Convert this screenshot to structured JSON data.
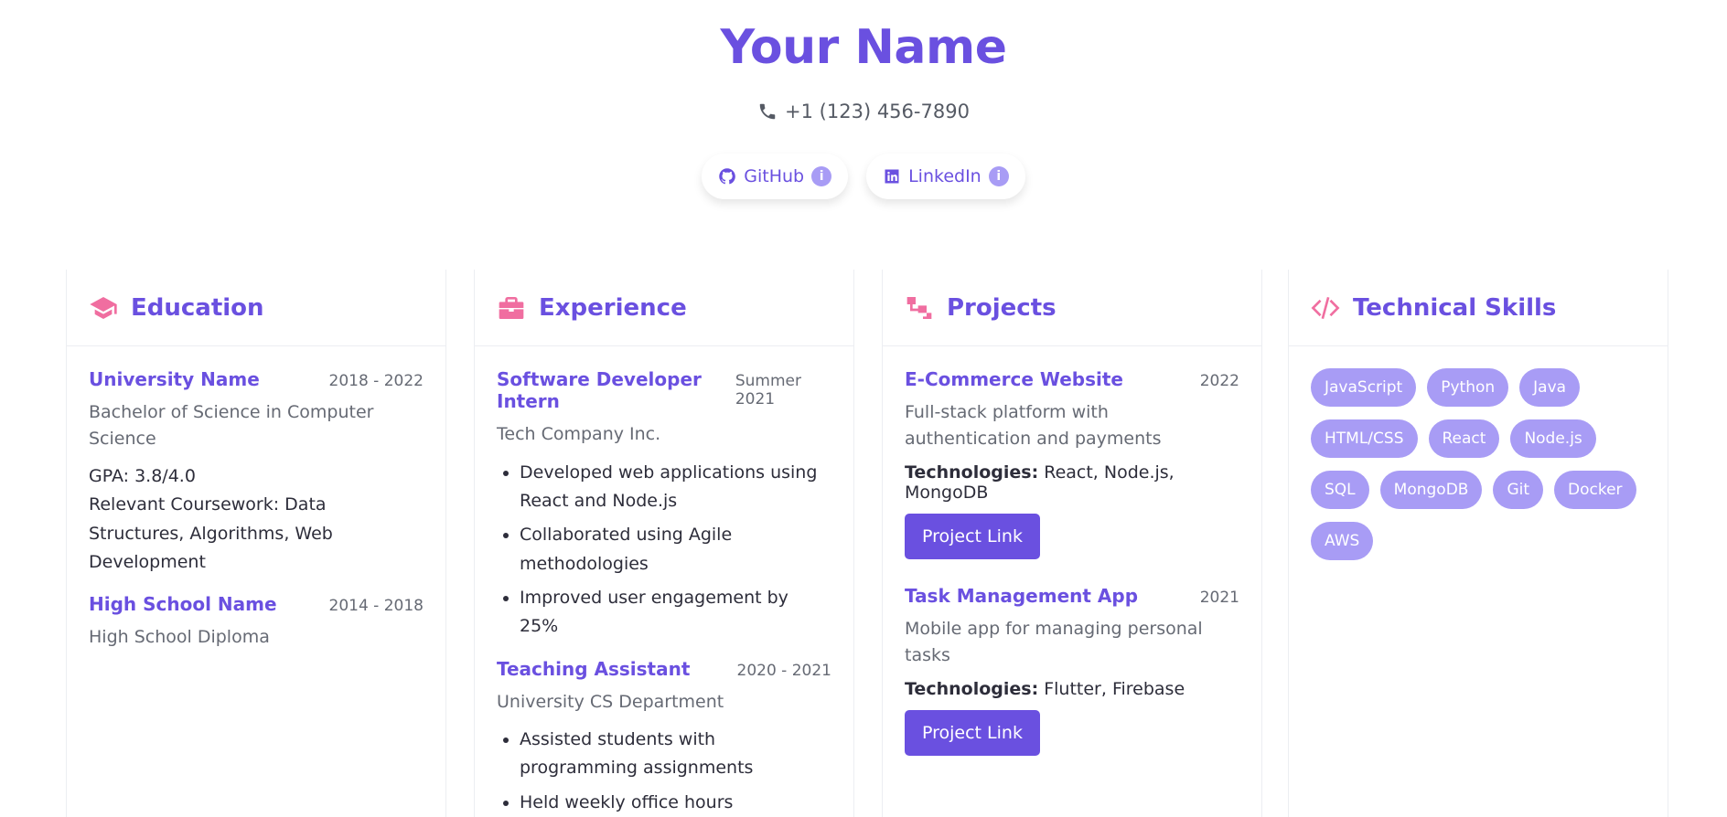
{
  "header": {
    "name": "Your Name",
    "phone": "+1 (123) 456-7890",
    "links": [
      {
        "label": "GitHub",
        "icon": "github-icon"
      },
      {
        "label": "LinkedIn",
        "icon": "linkedin-icon"
      }
    ]
  },
  "education": {
    "title": "Education",
    "entries": [
      {
        "title": "University Name",
        "date": "2018 - 2022",
        "subtitle": "Bachelor of Science in Computer Science",
        "gpa": "GPA: 3.8/4.0",
        "coursework": "Relevant Coursework: Data Structures, Algorithms, Web Development"
      },
      {
        "title": "High School Name",
        "date": "2014 - 2018",
        "subtitle": "High School Diploma"
      }
    ]
  },
  "experience": {
    "title": "Experience",
    "entries": [
      {
        "title": "Software Developer Intern",
        "date": "Summer 2021",
        "subtitle": "Tech Company Inc.",
        "bullets": [
          "Developed web applications using React and Node.js",
          "Collaborated using Agile methodologies",
          "Improved user engagement by 25%"
        ]
      },
      {
        "title": "Teaching Assistant",
        "date": "2020 - 2021",
        "subtitle": "University CS Department",
        "bullets": [
          "Assisted students with programming assignments",
          "Held weekly office hours"
        ]
      }
    ]
  },
  "projects": {
    "title": "Projects",
    "tech_label": "Technologies:",
    "entries": [
      {
        "title": "E-Commerce Website",
        "date": "2022",
        "description": "Full-stack platform with authentication and payments",
        "technologies": "React, Node.js, MongoDB",
        "button": "Project Link"
      },
      {
        "title": "Task Management App",
        "date": "2021",
        "description": "Mobile app for managing personal tasks",
        "technologies": "Flutter, Firebase",
        "button": "Project Link"
      }
    ]
  },
  "skills": {
    "title": "Technical Skills",
    "items": [
      "JavaScript",
      "Python",
      "Java",
      "HTML/CSS",
      "React",
      "Node.js",
      "SQL",
      "MongoDB",
      "Git",
      "Docker",
      "AWS"
    ]
  },
  "colors": {
    "accent": "#6a50e0",
    "icon_pink": "#f06ea0",
    "skill_pill": "#a89cf5"
  }
}
